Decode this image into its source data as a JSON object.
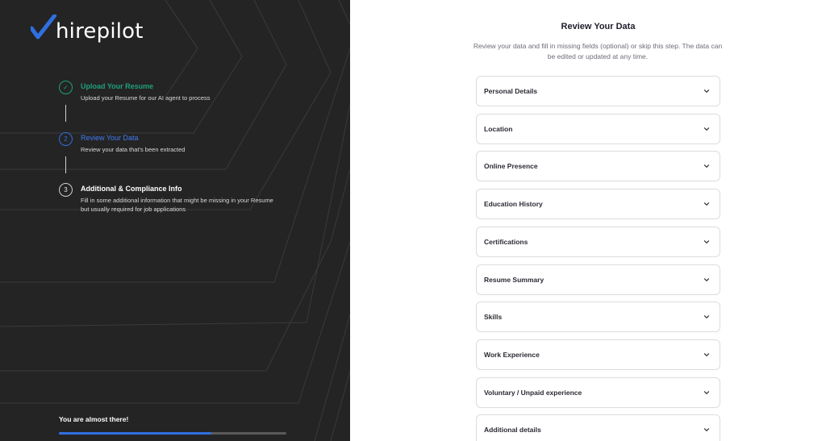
{
  "brand": {
    "name": "hirepilot",
    "accent": "#2f6fe0"
  },
  "steps": [
    {
      "number": "✓",
      "title": "Upload Your Resume",
      "description": "Upload your Resume for our AI agent to process",
      "status": "completed",
      "color": "#1fa07a"
    },
    {
      "number": "2",
      "title": "Review Your Data",
      "description": "Review your data that's been extracted",
      "status": "current",
      "color": "#2f6fe0"
    },
    {
      "number": "3",
      "title": "Additional & Compliance Info",
      "description": "Fill in some additional information that might be missing in your Resume but usually required for job applications",
      "status": "upcoming",
      "color": "#ffffff"
    }
  ],
  "progress": {
    "label": "You are almost there!",
    "percent": 67
  },
  "main": {
    "title": "Review Your Data",
    "subtitle": "Review your data and fill in missing fields (optional) or skip this step. The data can be edited or updated at any time.",
    "sections": [
      {
        "label": "Personal Details",
        "icon": "chevron-down-icon"
      },
      {
        "label": "Location",
        "icon": "chevron-down-icon"
      },
      {
        "label": "Online Presence",
        "icon": "chevron-down-icon"
      },
      {
        "label": "Education History",
        "icon": "chevron-down-icon"
      },
      {
        "label": "Certifications",
        "icon": "chevron-down-icon"
      },
      {
        "label": "Resume Summary",
        "icon": "chevron-down-icon"
      },
      {
        "label": "Skills",
        "icon": "chevron-down-icon"
      },
      {
        "label": "Work Experience",
        "icon": "chevron-down-icon"
      },
      {
        "label": "Voluntary / Unpaid experience",
        "icon": "chevron-down-icon"
      },
      {
        "label": "Additional details",
        "icon": "chevron-down-icon"
      }
    ]
  }
}
